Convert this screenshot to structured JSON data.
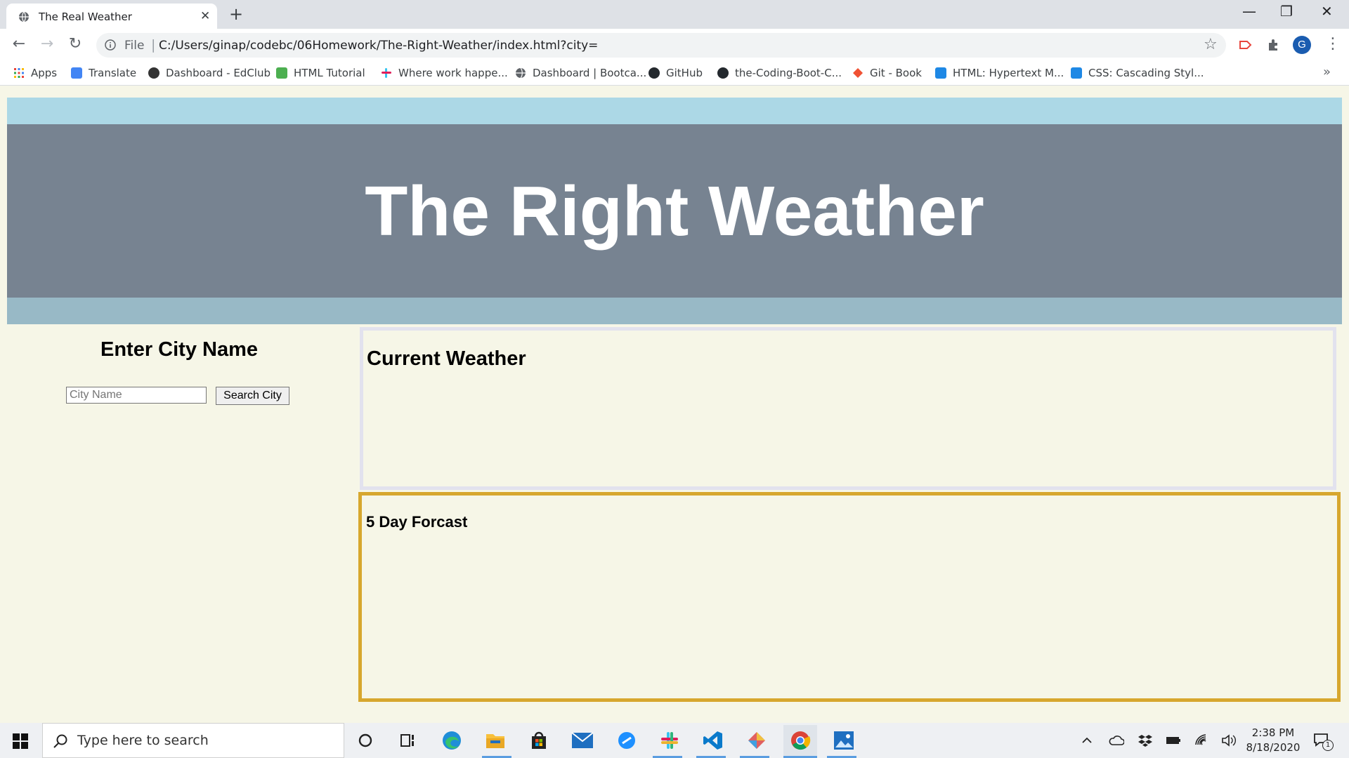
{
  "browser": {
    "tab_title": "The Real Weather",
    "tab_close": "✕",
    "new_tab": "+",
    "window_controls": [
      "—",
      "❐",
      "✕"
    ],
    "omnibox": {
      "scheme_label": "File",
      "separator": "|",
      "url": "C:/Users/ginap/codebc/06Homework/The-Right-Weather/index.html?city="
    },
    "nav": {
      "back": "←",
      "forward": "→",
      "reload": "↻"
    },
    "star": "☆",
    "profile_initial": "G",
    "menu": "⋮",
    "bookmarks": [
      {
        "label": "Apps",
        "icon": "apps-grid-icon",
        "color": "#e8453c"
      },
      {
        "label": "Translate",
        "icon": "google-translate-icon",
        "color": "#4285f4"
      },
      {
        "label": "Dashboard - EdClub",
        "icon": "edclub-icon",
        "color": "#333333"
      },
      {
        "label": "HTML Tutorial",
        "icon": "w3schools-icon",
        "color": "#4caf50"
      },
      {
        "label": "Where work happe...",
        "icon": "slack-icon",
        "color": "#e01e5a"
      },
      {
        "label": "Dashboard | Bootca...",
        "icon": "globe-icon",
        "color": "#5f6368"
      },
      {
        "label": "GitHub",
        "icon": "github-icon",
        "color": "#24292e"
      },
      {
        "label": "the-Coding-Boot-C...",
        "icon": "github-icon",
        "color": "#24292e"
      },
      {
        "label": "Git - Book",
        "icon": "git-icon",
        "color": "#f05133"
      },
      {
        "label": "HTML: Hypertext M...",
        "icon": "mdn-icon",
        "color": "#1e88e5"
      },
      {
        "label": "CSS: Cascading Styl...",
        "icon": "mdn-icon",
        "color": "#1e88e5"
      }
    ],
    "bookmarks_more": "»"
  },
  "page": {
    "site_title": "The Right Weather",
    "search": {
      "heading": "Enter City Name",
      "placeholder": "City Name",
      "value": "",
      "button_label": "Search City"
    },
    "current": {
      "heading": "Current Weather"
    },
    "forecast": {
      "heading": "5 Day Forcast"
    },
    "colors": {
      "header_top": "#acd8e6",
      "header_main": "#778391",
      "header_bottom": "#98b9c6",
      "page_bg": "#f6f6e7",
      "current_border": "#e2e2ee",
      "forecast_border": "#d7a72e"
    }
  },
  "taskbar": {
    "search_placeholder": "Type here to search",
    "apps": [
      "cortana-icon",
      "task-view-icon",
      "edge-icon",
      "file-explorer-icon",
      "store-icon",
      "mail-icon",
      "cloud-app-icon",
      "slack-icon",
      "vscode-icon",
      "git-kraken-icon",
      "chrome-icon",
      "photos-icon"
    ],
    "time": "2:38 PM",
    "date": "8/18/2020",
    "notification_count": "1"
  }
}
